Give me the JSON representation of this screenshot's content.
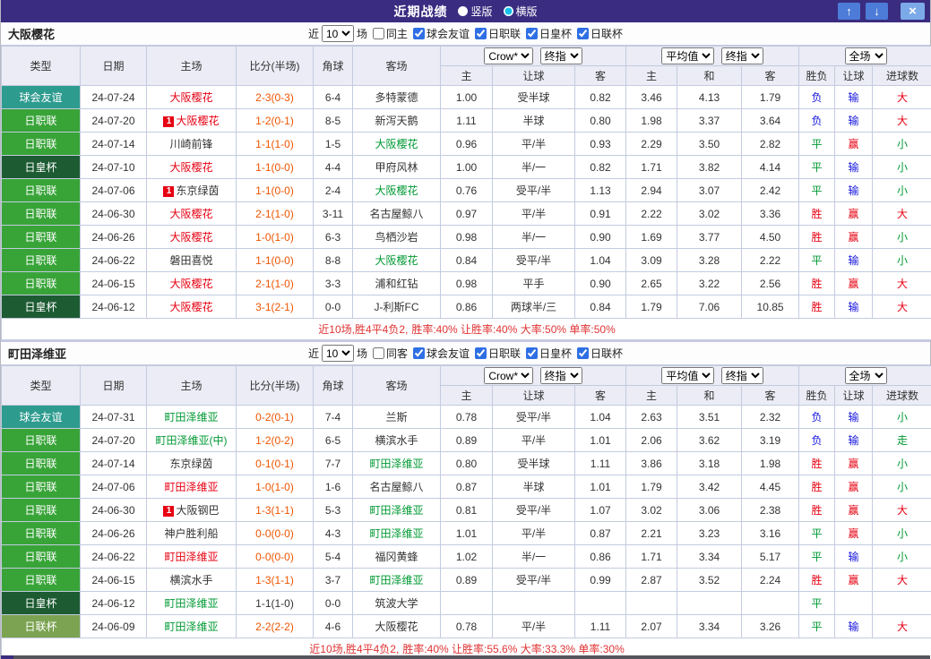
{
  "titlebar": {
    "title": "近期战绩",
    "radio_vertical": "竖版",
    "radio_horizontal": "横版",
    "up_icon": "↑",
    "down_icon": "↓",
    "close_icon": "×"
  },
  "filters": {
    "near": "近",
    "count": "10",
    "games": "场",
    "company": "Crow*",
    "final": "终指",
    "average": "平均值",
    "scope": "全场",
    "leagues": [
      "球会友谊",
      "日职联",
      "日皇杯",
      "日联杯"
    ]
  },
  "columns": {
    "type": "类型",
    "date": "日期",
    "home": "主场",
    "score": "比分(半场)",
    "corner": "角球",
    "away": "客场",
    "odds_home": "主",
    "handicap": "让球",
    "odds_away": "客",
    "avg_home": "主",
    "avg_draw": "和",
    "avg_away": "客",
    "result": "胜负",
    "let": "让球",
    "goals": "进球数"
  },
  "sections": [
    {
      "team": "大阪樱花",
      "same_label": "同主",
      "summary": {
        "prefix": "近10场,胜4平4负2,",
        "stats": "胜率:40% 让胜率:40% 大率:50% 单率:50%"
      },
      "rows": [
        {
          "type": "球会友谊",
          "type_cls": "t-friendly",
          "date": "24-07-24",
          "home": "大阪樱花",
          "home_color": "red",
          "home_badge": false,
          "score": "2-3(0-3)",
          "score_color": "orange",
          "corner": "6-4",
          "away": "多特蒙德",
          "away_color": "dark",
          "odds_home": "1.00",
          "handicap": "受半球",
          "odds_away": "0.82",
          "avg_home": "3.46",
          "avg_draw": "4.13",
          "avg_away": "1.79",
          "result": "负",
          "result_color": "blue",
          "let_result": "输",
          "let_color": "blue",
          "goal": "大",
          "goal_color": "red"
        },
        {
          "type": "日职联",
          "type_cls": "t-league",
          "date": "24-07-20",
          "home": "大阪樱花",
          "home_color": "red",
          "home_badge": true,
          "score": "1-2(0-1)",
          "score_color": "orange",
          "corner": "8-5",
          "away": "新泻天鹅",
          "away_color": "dark",
          "odds_home": "1.11",
          "handicap": "半球",
          "odds_away": "0.80",
          "avg_home": "1.98",
          "avg_draw": "3.37",
          "avg_away": "3.64",
          "result": "负",
          "result_color": "blue",
          "let_result": "输",
          "let_color": "blue",
          "goal": "大",
          "goal_color": "red"
        },
        {
          "type": "日职联",
          "type_cls": "t-league",
          "date": "24-07-14",
          "home": "川崎前锋",
          "home_color": "dark",
          "home_badge": false,
          "score": "1-1(1-0)",
          "score_color": "orange",
          "corner": "1-5",
          "away": "大阪樱花",
          "away_color": "green",
          "odds_home": "0.96",
          "handicap": "平/半",
          "odds_away": "0.93",
          "avg_home": "2.29",
          "avg_draw": "3.50",
          "avg_away": "2.82",
          "result": "平",
          "result_color": "green",
          "let_result": "赢",
          "let_color": "red",
          "goal": "小",
          "goal_color": "green"
        },
        {
          "type": "日皇杯",
          "type_cls": "t-emperor",
          "date": "24-07-10",
          "home": "大阪樱花",
          "home_color": "red",
          "home_badge": false,
          "score": "1-1(0-0)",
          "score_color": "orange",
          "corner": "4-4",
          "away": "甲府风林",
          "away_color": "dark",
          "odds_home": "1.00",
          "handicap": "半/一",
          "odds_away": "0.82",
          "avg_home": "1.71",
          "avg_draw": "3.82",
          "avg_away": "4.14",
          "result": "平",
          "result_color": "green",
          "let_result": "输",
          "let_color": "blue",
          "goal": "小",
          "goal_color": "green"
        },
        {
          "type": "日职联",
          "type_cls": "t-league",
          "date": "24-07-06",
          "home": "东京绿茵",
          "home_color": "dark",
          "home_badge": true,
          "score": "1-1(0-0)",
          "score_color": "orange",
          "corner": "2-4",
          "away": "大阪樱花",
          "away_color": "green",
          "odds_home": "0.76",
          "handicap": "受平/半",
          "odds_away": "1.13",
          "avg_home": "2.94",
          "avg_draw": "3.07",
          "avg_away": "2.42",
          "result": "平",
          "result_color": "green",
          "let_result": "输",
          "let_color": "blue",
          "goal": "小",
          "goal_color": "green"
        },
        {
          "type": "日职联",
          "type_cls": "t-league",
          "date": "24-06-30",
          "home": "大阪樱花",
          "home_color": "red",
          "home_badge": false,
          "score": "2-1(1-0)",
          "score_color": "orange",
          "corner": "3-11",
          "away": "名古屋鲸八",
          "away_color": "dark",
          "odds_home": "0.97",
          "handicap": "平/半",
          "odds_away": "0.91",
          "avg_home": "2.22",
          "avg_draw": "3.02",
          "avg_away": "3.36",
          "result": "胜",
          "result_color": "red",
          "let_result": "赢",
          "let_color": "red",
          "goal": "大",
          "goal_color": "red"
        },
        {
          "type": "日职联",
          "type_cls": "t-league",
          "date": "24-06-26",
          "home": "大阪樱花",
          "home_color": "red",
          "home_badge": false,
          "score": "1-0(1-0)",
          "score_color": "orange",
          "corner": "6-3",
          "away": "鸟栖沙岩",
          "away_color": "dark",
          "odds_home": "0.98",
          "handicap": "半/一",
          "odds_away": "0.90",
          "avg_home": "1.69",
          "avg_draw": "3.77",
          "avg_away": "4.50",
          "result": "胜",
          "result_color": "red",
          "let_result": "赢",
          "let_color": "red",
          "goal": "小",
          "goal_color": "green"
        },
        {
          "type": "日职联",
          "type_cls": "t-league",
          "date": "24-06-22",
          "home": "磐田喜悦",
          "home_color": "dark",
          "home_badge": false,
          "score": "1-1(0-0)",
          "score_color": "orange",
          "corner": "8-8",
          "away": "大阪樱花",
          "away_color": "green",
          "odds_home": "0.84",
          "handicap": "受平/半",
          "odds_away": "1.04",
          "avg_home": "3.09",
          "avg_draw": "3.28",
          "avg_away": "2.22",
          "result": "平",
          "result_color": "green",
          "let_result": "输",
          "let_color": "blue",
          "goal": "小",
          "goal_color": "green"
        },
        {
          "type": "日职联",
          "type_cls": "t-league",
          "date": "24-06-15",
          "home": "大阪樱花",
          "home_color": "red",
          "home_badge": false,
          "score": "2-1(1-0)",
          "score_color": "orange",
          "corner": "3-3",
          "away": "浦和红钻",
          "away_color": "dark",
          "odds_home": "0.98",
          "handicap": "平手",
          "odds_away": "0.90",
          "avg_home": "2.65",
          "avg_draw": "3.22",
          "avg_away": "2.56",
          "result": "胜",
          "result_color": "red",
          "let_result": "赢",
          "let_color": "red",
          "goal": "大",
          "goal_color": "red"
        },
        {
          "type": "日皇杯",
          "type_cls": "t-emperor",
          "date": "24-06-12",
          "home": "大阪樱花",
          "home_color": "red",
          "home_badge": false,
          "score": "3-1(2-1)",
          "score_color": "orange",
          "corner": "0-0",
          "away": "J-利斯FC",
          "away_color": "dark",
          "odds_home": "0.86",
          "handicap": "两球半/三",
          "odds_away": "0.84",
          "avg_home": "1.79",
          "avg_draw": "7.06",
          "avg_away": "10.85",
          "result": "胜",
          "result_color": "red",
          "let_result": "输",
          "let_color": "blue",
          "goal": "大",
          "goal_color": "red"
        }
      ]
    },
    {
      "team": "町田泽维亚",
      "same_label": "同客",
      "summary": {
        "prefix": "近10场,胜4平4负2,",
        "stats": "胜率:40% 让胜率:55.6% 大率:33.3% 单率:30%"
      },
      "rows": [
        {
          "type": "球会友谊",
          "type_cls": "t-friendly",
          "date": "24-07-31",
          "home": "町田泽维亚",
          "home_color": "green",
          "home_badge": false,
          "score": "0-2(0-1)",
          "score_color": "orange",
          "corner": "7-4",
          "away": "兰斯",
          "away_color": "dark",
          "odds_home": "0.78",
          "handicap": "受平/半",
          "odds_away": "1.04",
          "avg_home": "2.63",
          "avg_draw": "3.51",
          "avg_away": "2.32",
          "result": "负",
          "result_color": "blue",
          "let_result": "输",
          "let_color": "blue",
          "goal": "小",
          "goal_color": "green"
        },
        {
          "type": "日职联",
          "type_cls": "t-league",
          "date": "24-07-20",
          "home": "町田泽维亚(中)",
          "home_color": "green",
          "home_badge": false,
          "score": "1-2(0-2)",
          "score_color": "orange",
          "corner": "6-5",
          "away": "横滨水手",
          "away_color": "dark",
          "odds_home": "0.89",
          "handicap": "平/半",
          "odds_away": "1.01",
          "avg_home": "2.06",
          "avg_draw": "3.62",
          "avg_away": "3.19",
          "result": "负",
          "result_color": "blue",
          "let_result": "输",
          "let_color": "blue",
          "goal": "走",
          "goal_color": "green"
        },
        {
          "type": "日职联",
          "type_cls": "t-league",
          "date": "24-07-14",
          "home": "东京绿茵",
          "home_color": "dark",
          "home_badge": false,
          "score": "0-1(0-1)",
          "score_color": "orange",
          "corner": "7-7",
          "away": "町田泽维亚",
          "away_color": "green",
          "odds_home": "0.80",
          "handicap": "受半球",
          "odds_away": "1.11",
          "avg_home": "3.86",
          "avg_draw": "3.18",
          "avg_away": "1.98",
          "result": "胜",
          "result_color": "red",
          "let_result": "赢",
          "let_color": "red",
          "goal": "小",
          "goal_color": "green"
        },
        {
          "type": "日职联",
          "type_cls": "t-league",
          "date": "24-07-06",
          "home": "町田泽维亚",
          "home_color": "red",
          "home_badge": false,
          "score": "1-0(1-0)",
          "score_color": "orange",
          "corner": "1-6",
          "away": "名古屋鲸八",
          "away_color": "dark",
          "odds_home": "0.87",
          "handicap": "半球",
          "odds_away": "1.01",
          "avg_home": "1.79",
          "avg_draw": "3.42",
          "avg_away": "4.45",
          "result": "胜",
          "result_color": "red",
          "let_result": "赢",
          "let_color": "red",
          "goal": "小",
          "goal_color": "green"
        },
        {
          "type": "日职联",
          "type_cls": "t-league",
          "date": "24-06-30",
          "home": "大阪钢巴",
          "home_color": "dark",
          "home_badge": true,
          "score": "1-3(1-1)",
          "score_color": "orange",
          "corner": "5-3",
          "away": "町田泽维亚",
          "away_color": "green",
          "odds_home": "0.81",
          "handicap": "受平/半",
          "odds_away": "1.07",
          "avg_home": "3.02",
          "avg_draw": "3.06",
          "avg_away": "2.38",
          "result": "胜",
          "result_color": "red",
          "let_result": "赢",
          "let_color": "red",
          "goal": "大",
          "goal_color": "red"
        },
        {
          "type": "日职联",
          "type_cls": "t-league",
          "date": "24-06-26",
          "home": "神户胜利船",
          "home_color": "dark",
          "home_badge": false,
          "score": "0-0(0-0)",
          "score_color": "orange",
          "corner": "4-3",
          "away": "町田泽维亚",
          "away_color": "green",
          "odds_home": "1.01",
          "handicap": "平/半",
          "odds_away": "0.87",
          "avg_home": "2.21",
          "avg_draw": "3.23",
          "avg_away": "3.16",
          "result": "平",
          "result_color": "green",
          "let_result": "赢",
          "let_color": "red",
          "goal": "小",
          "goal_color": "green"
        },
        {
          "type": "日职联",
          "type_cls": "t-league",
          "date": "24-06-22",
          "home": "町田泽维亚",
          "home_color": "red",
          "home_badge": false,
          "score": "0-0(0-0)",
          "score_color": "orange",
          "corner": "5-4",
          "away": "福冈黄蜂",
          "away_color": "dark",
          "odds_home": "1.02",
          "handicap": "半/一",
          "odds_away": "0.86",
          "avg_home": "1.71",
          "avg_draw": "3.34",
          "avg_away": "5.17",
          "result": "平",
          "result_color": "green",
          "let_result": "输",
          "let_color": "blue",
          "goal": "小",
          "goal_color": "green"
        },
        {
          "type": "日职联",
          "type_cls": "t-league",
          "date": "24-06-15",
          "home": "横滨水手",
          "home_color": "dark",
          "home_badge": false,
          "score": "1-3(1-1)",
          "score_color": "orange",
          "corner": "3-7",
          "away": "町田泽维亚",
          "away_color": "green",
          "odds_home": "0.89",
          "handicap": "受平/半",
          "odds_away": "0.99",
          "avg_home": "2.87",
          "avg_draw": "3.52",
          "avg_away": "2.24",
          "result": "胜",
          "result_color": "red",
          "let_result": "赢",
          "let_color": "red",
          "goal": "大",
          "goal_color": "red"
        },
        {
          "type": "日皇杯",
          "type_cls": "t-emperor",
          "date": "24-06-12",
          "home": "町田泽维亚",
          "home_color": "green",
          "home_badge": false,
          "score": "1-1(1-0)",
          "score_color": "dark",
          "corner": "0-0",
          "away": "筑波大学",
          "away_color": "dark",
          "odds_home": "",
          "handicap": "",
          "odds_away": "",
          "avg_home": "",
          "avg_draw": "",
          "avg_away": "",
          "result": "平",
          "result_color": "green",
          "let_result": "",
          "let_color": "",
          "goal": "",
          "goal_color": ""
        },
        {
          "type": "日联杯",
          "type_cls": "t-lcup",
          "date": "24-06-09",
          "home": "町田泽维亚",
          "home_color": "green",
          "home_badge": false,
          "score": "2-2(2-2)",
          "score_color": "orange",
          "corner": "4-6",
          "away": "大阪樱花",
          "away_color": "dark",
          "odds_home": "0.78",
          "handicap": "平/半",
          "odds_away": "1.11",
          "avg_home": "2.07",
          "avg_draw": "3.34",
          "avg_away": "3.26",
          "result": "平",
          "result_color": "green",
          "let_result": "输",
          "let_color": "blue",
          "goal": "大",
          "goal_color": "red"
        }
      ]
    }
  ]
}
